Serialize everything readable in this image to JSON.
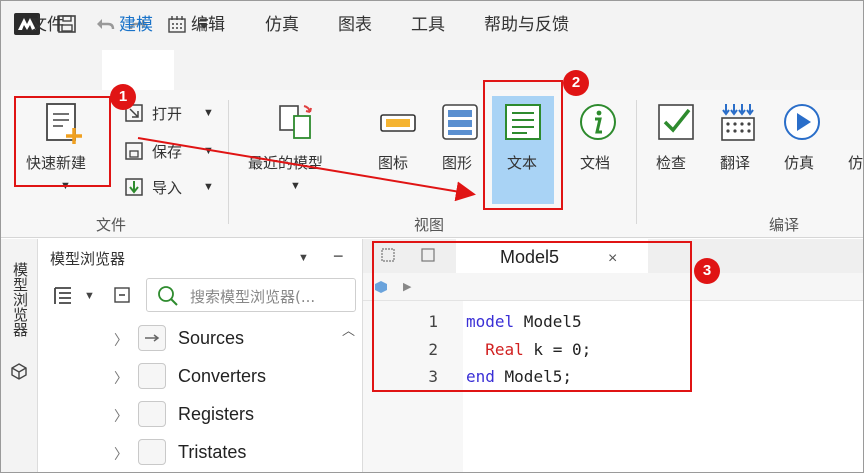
{
  "menu": {
    "tabs": [
      "文件",
      "建模",
      "编辑",
      "仿真",
      "图表",
      "工具",
      "帮助与反馈"
    ]
  },
  "ribbon": {
    "file_group": {
      "quick_new": "快速新建",
      "open": "打开",
      "save": "保存",
      "import": "导入",
      "label": "文件"
    },
    "view_group": {
      "recent_models": "最近的模型",
      "icon": "图标",
      "diagram": "图形",
      "text": "文本",
      "doc": "文档",
      "label": "视图"
    },
    "compile_group": {
      "check": "检查",
      "translate": "翻译",
      "simulate": "仿真",
      "label": "编译"
    }
  },
  "side_panel": {
    "vertical_label": "模型浏览器"
  },
  "browser": {
    "title": "模型浏览器",
    "search_placeholder": "搜索模型浏览器(...",
    "items": [
      "Sources",
      "Converters",
      "Registers",
      "Tristates"
    ]
  },
  "editor": {
    "tab_title": "Model5",
    "close": "×",
    "lines": [
      {
        "num": "1",
        "kw1": "model",
        "rest": " Model5"
      },
      {
        "num": "2",
        "indent": "  ",
        "type": "Real",
        "rest": " k = 0;"
      },
      {
        "num": "3",
        "kw1": "end",
        "rest": " Model5;"
      }
    ]
  },
  "annotations": {
    "badge_1": "1",
    "badge_2": "2",
    "badge_3": "3",
    "color": "#e01414"
  },
  "colors": {
    "accent": "#1a73c9",
    "selected_bg": "#a9d3f5",
    "keyword": "#3a2fd6",
    "type": "#d12020"
  }
}
